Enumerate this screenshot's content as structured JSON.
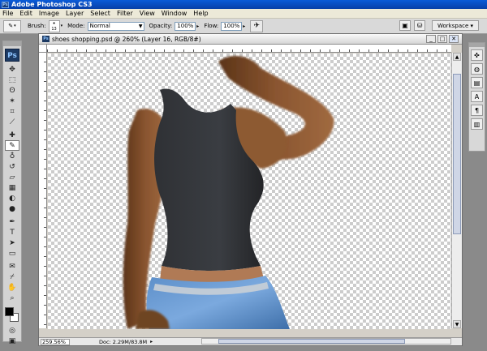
{
  "app": {
    "title": "Adobe Photoshop CS3",
    "logo": "Ps"
  },
  "menu": [
    "File",
    "Edit",
    "Image",
    "Layer",
    "Select",
    "Filter",
    "View",
    "Window",
    "Help"
  ],
  "options": {
    "brush_label": "Brush:",
    "brush_size": "13",
    "mode_label": "Mode:",
    "mode_value": "Normal",
    "opacity_label": "Opacity:",
    "opacity_value": "100%",
    "flow_label": "Flow:",
    "flow_value": "100%",
    "workspace_label": "Workspace ▾"
  },
  "document": {
    "title": "shoes shopping.psd @ 260% (Layer 16, RGB/8#)",
    "zoom": "259.56%",
    "doc_info": "Doc: 2.29M/83.8M"
  },
  "tools": [
    {
      "name": "move-tool-icon",
      "glyph": "✥"
    },
    {
      "name": "marquee-tool-icon",
      "glyph": "⬚"
    },
    {
      "name": "lasso-tool-icon",
      "glyph": "ʘ"
    },
    {
      "name": "magic-wand-tool-icon",
      "glyph": "✶"
    },
    {
      "name": "crop-tool-icon",
      "glyph": "⌗"
    },
    {
      "name": "slice-tool-icon",
      "glyph": "⟋"
    },
    {
      "name": "healing-brush-tool-icon",
      "glyph": "✚"
    },
    {
      "name": "brush-tool-icon",
      "glyph": "✎"
    },
    {
      "name": "clone-stamp-tool-icon",
      "glyph": "♁"
    },
    {
      "name": "history-brush-tool-icon",
      "glyph": "↺"
    },
    {
      "name": "eraser-tool-icon",
      "glyph": "▱"
    },
    {
      "name": "gradient-tool-icon",
      "glyph": "▦"
    },
    {
      "name": "blur-tool-icon",
      "glyph": "◐"
    },
    {
      "name": "dodge-tool-icon",
      "glyph": "●"
    },
    {
      "name": "pen-tool-icon",
      "glyph": "✒"
    },
    {
      "name": "type-tool-icon",
      "glyph": "T"
    },
    {
      "name": "path-selection-tool-icon",
      "glyph": "➤"
    },
    {
      "name": "shape-tool-icon",
      "glyph": "▭"
    },
    {
      "name": "notes-tool-icon",
      "glyph": "✉"
    },
    {
      "name": "eyedropper-tool-icon",
      "glyph": "⌿"
    },
    {
      "name": "hand-tool-icon",
      "glyph": "✋"
    },
    {
      "name": "zoom-tool-icon",
      "glyph": "⌕"
    }
  ],
  "dock": [
    {
      "name": "navigator-panel-icon",
      "glyph": "✜"
    },
    {
      "name": "color-panel-icon",
      "glyph": "◍"
    },
    {
      "name": "swatches-panel-icon",
      "glyph": "▤"
    },
    {
      "name": "character-panel-icon",
      "glyph": "A"
    },
    {
      "name": "paragraph-panel-icon",
      "glyph": "¶"
    },
    {
      "name": "layers-panel-icon",
      "glyph": "▥"
    }
  ],
  "colors": {
    "titlebar": "#0a5bd8",
    "foreground": "#000000",
    "background": "#ffffff"
  }
}
